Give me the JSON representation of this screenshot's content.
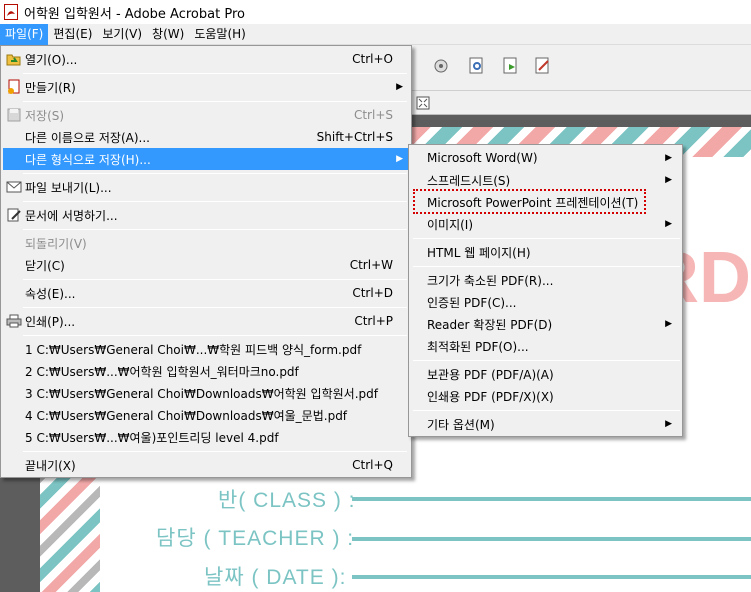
{
  "window": {
    "title": "어학원 입학원서 - Adobe Acrobat Pro"
  },
  "menubar": [
    {
      "label": "파일(F)",
      "active": true
    },
    {
      "label": "편집(E)",
      "active": false
    },
    {
      "label": "보기(V)",
      "active": false
    },
    {
      "label": "창(W)",
      "active": false
    },
    {
      "label": "도움말(H)",
      "active": false
    }
  ],
  "file_menu": {
    "open": {
      "label": "열기(O)...",
      "shortcut": "Ctrl+O"
    },
    "create": {
      "label": "만들기(R)"
    },
    "save": {
      "label": "저장(S)",
      "shortcut": "Ctrl+S"
    },
    "save_as": {
      "label": "다른 이름으로 저장(A)...",
      "shortcut": "Shift+Ctrl+S"
    },
    "save_other": {
      "label": "다른 형식으로 저장(H)..."
    },
    "send": {
      "label": "파일 보내기(L)..."
    },
    "sign": {
      "label": "문서에 서명하기..."
    },
    "revert": {
      "label": "되돌리기(V)"
    },
    "close": {
      "label": "닫기(C)",
      "shortcut": "Ctrl+W"
    },
    "properties": {
      "label": "속성(E)...",
      "shortcut": "Ctrl+D"
    },
    "print": {
      "label": "인쇄(P)...",
      "shortcut": "Ctrl+P"
    },
    "recent": [
      "1 C:₩Users₩General Choi₩...₩학원 피드백 양식_form.pdf",
      "2 C:₩Users₩...₩어학원 입학원서_워터마크no.pdf",
      "3 C:₩Users₩General Choi₩Downloads₩어학원 입학원서.pdf",
      "4 C:₩Users₩General Choi₩Downloads₩여울_문법.pdf",
      "5 C:₩Users₩...₩여울)포인트리딩 level 4.pdf"
    ],
    "exit": {
      "label": "끝내기(X)",
      "shortcut": "Ctrl+Q"
    }
  },
  "submenu": {
    "word": "Microsoft Word(W)",
    "spreadsheet": "스프레드시트(S)",
    "powerpoint": "Microsoft PowerPoint 프레젠테이션(T)",
    "image": "이미지(I)",
    "html": "HTML 웹 페이지(H)",
    "reduced": "크기가 축소된 PDF(R)...",
    "certified": "인증된 PDF(C)...",
    "reader_ext": "Reader 확장된 PDF(D)",
    "optimized": "최적화된 PDF(O)...",
    "archive": "보관용 PDF (PDF/A)(A)",
    "print_pdf": "인쇄용 PDF (PDF/X)(X)",
    "other": "기타 옵션(M)"
  },
  "document": {
    "big_text": "RD",
    "class_label": "반( CLASS ) :",
    "teacher_label": "담당 ( TEACHER ) :",
    "date_label": "날짜 ( DATE ):"
  },
  "colors": {
    "highlight": "#3399ff",
    "teal": "#7cc4c4",
    "pink": "#f3a8a8",
    "focus": "#d40000"
  },
  "icons": [
    "pdf-app-icon",
    "open-folder-icon",
    "create-icon",
    "save-disk-icon",
    "mail-icon",
    "sign-pen-icon",
    "print-icon"
  ]
}
